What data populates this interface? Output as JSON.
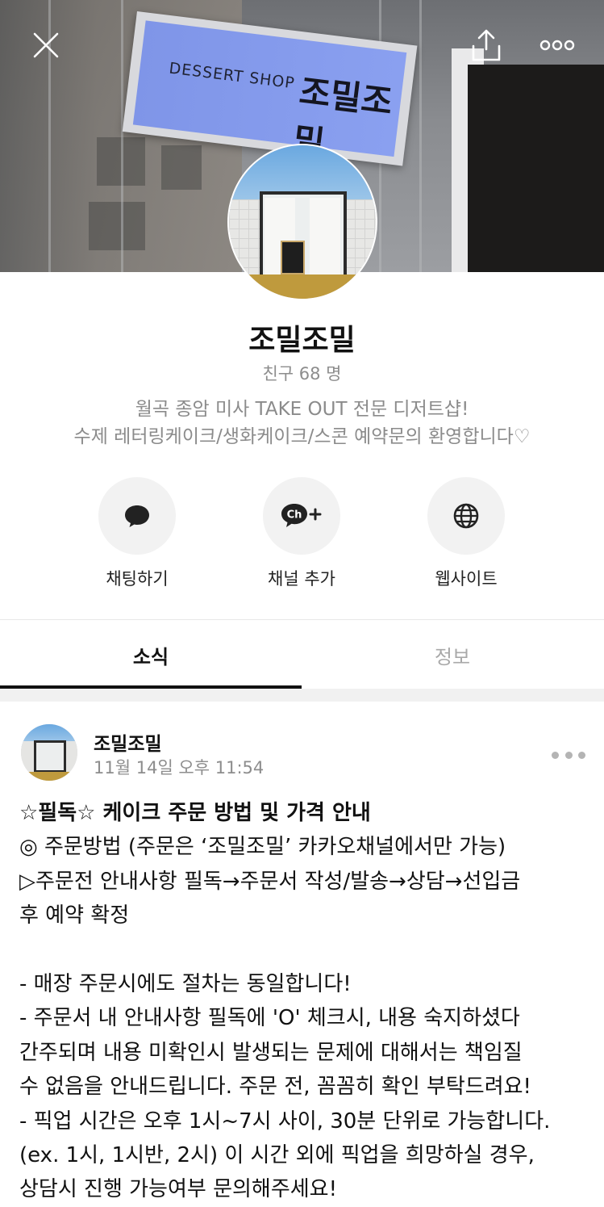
{
  "header": {
    "close_icon": "close-icon",
    "share_icon": "share-icon",
    "more_icon": "more-icon",
    "cover_sign_text_en": "DESSERT SHOP",
    "cover_sign_text_ko": "조밀조밀"
  },
  "profile": {
    "name": "조밀조밀",
    "friends": "친구 68 명",
    "description_lines": [
      "월곡 종암 미사 TAKE OUT 전문 디저트샵!",
      "수제 레터링케이크/생화케이크/스콘 예약문의 환영합니다♡"
    ]
  },
  "actions": [
    {
      "label": "채팅하기",
      "icon": "chat-icon"
    },
    {
      "label": "채널 추가",
      "icon": "channel-add-icon"
    },
    {
      "label": "웹사이트",
      "icon": "globe-icon"
    }
  ],
  "tabs": [
    {
      "label": "소식",
      "active": true
    },
    {
      "label": "정보",
      "active": false
    }
  ],
  "post": {
    "author": "조밀조밀",
    "time": "11월 14일 오후 11:54",
    "lines": [
      "☆필독☆ 케이크 주문 방법 및 가격 안내",
      "◎ 주문방법 (주문은 ‘조밀조밀’ 카카오채널에서만 가능)",
      "▷주문전 안내사항 필독→주문서 작성/발송→상담→선입금",
      "후 예약 확정",
      "",
      "- 매장 주문시에도 절차는 동일합니다!",
      "- 주문서 내 안내사항 필독에 'O' 체크시, 내용 숙지하셨다",
      "간주되며 내용 미확인시 발생되는 문제에 대해서는 책임질",
      "수 없음을 안내드립니다. 주문 전, 꼼꼼히 확인 부탁드려요!",
      "- 픽업 시간은 오후 1시~7시 사이, 30분 단위로 가능합니다.",
      "(ex. 1시, 1시반, 2시) 이 시간 외에 픽업을 희망하실 경우,",
      "상담시 진행 가능여부 문의해주세요!"
    ]
  }
}
